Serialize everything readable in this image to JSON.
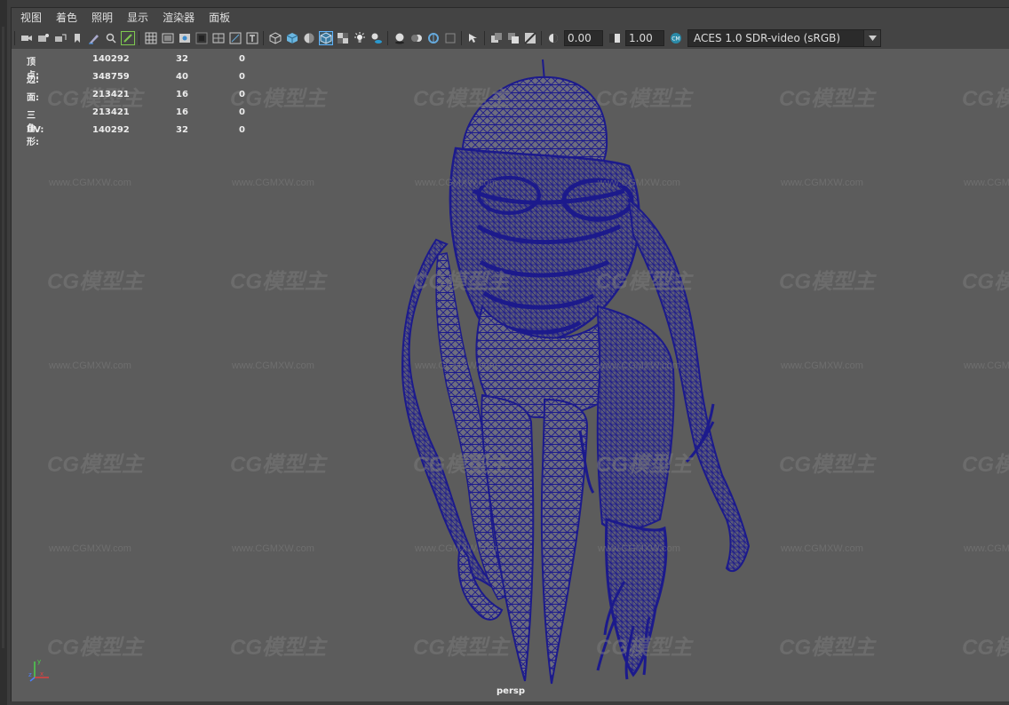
{
  "menu": [
    "视图",
    "着色",
    "照明",
    "显示",
    "渲染器",
    "面板"
  ],
  "toolbar": {
    "exposure": "0.00",
    "gamma": "1.00",
    "color_space": "ACES 1.0 SDR-video (sRGB)"
  },
  "hud": {
    "rows": [
      {
        "label": "顶点:",
        "v1": "140292",
        "v2": "32",
        "v3": "0"
      },
      {
        "label": "边:",
        "v1": "348759",
        "v2": "40",
        "v3": "0"
      },
      {
        "label": "面:",
        "v1": "213421",
        "v2": "16",
        "v3": "0"
      },
      {
        "label": "三角形:",
        "v1": "213421",
        "v2": "16",
        "v3": "0"
      },
      {
        "label": "UV:",
        "v1": "140292",
        "v2": "32",
        "v3": "0"
      }
    ]
  },
  "watermark": {
    "logo": "CG模型主",
    "url": "www.CGMXW.com"
  },
  "camera_label": "persp",
  "colors": {
    "wireframe": "#1c1a8c",
    "viewport_bg": "#5c5c5c",
    "panel_bg": "#444444",
    "highlight": "#5eb4ff"
  }
}
